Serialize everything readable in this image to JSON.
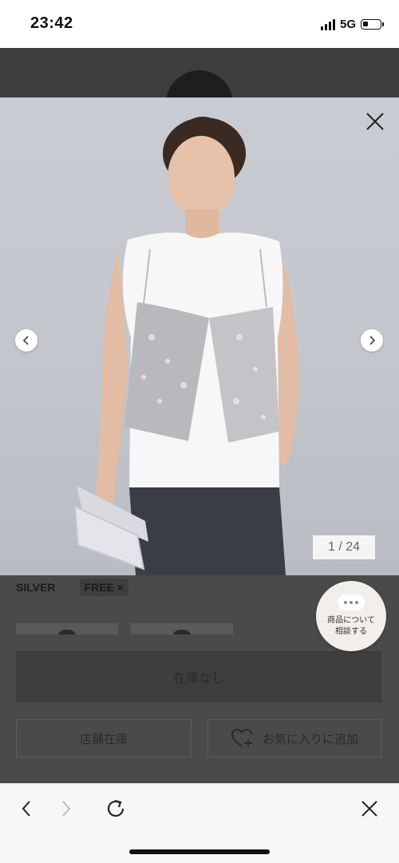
{
  "status_bar": {
    "time": "23:42",
    "network": "5G",
    "signal_bars": 4,
    "battery_level": 0.25
  },
  "product": {
    "color_label": "SILVER",
    "size_label": "FREE ×",
    "stock_button": "在庫なし",
    "store_stock_button": "店舗在庫",
    "favorite_button": "お気に入りに追加"
  },
  "chat": {
    "line1": "商品について",
    "line2": "相談する"
  },
  "gallery": {
    "counter": "1 / 24",
    "current": 1,
    "total": 24
  },
  "toolbar": {
    "icons": [
      "back-icon",
      "forward-icon",
      "reload-icon",
      "close-icon"
    ]
  },
  "colors": {
    "overlay": "#4a4a4a",
    "photo_background": "#c6c9cf",
    "toolbar": "#f7f7f7",
    "chat_bubble": "#f2eeea"
  }
}
